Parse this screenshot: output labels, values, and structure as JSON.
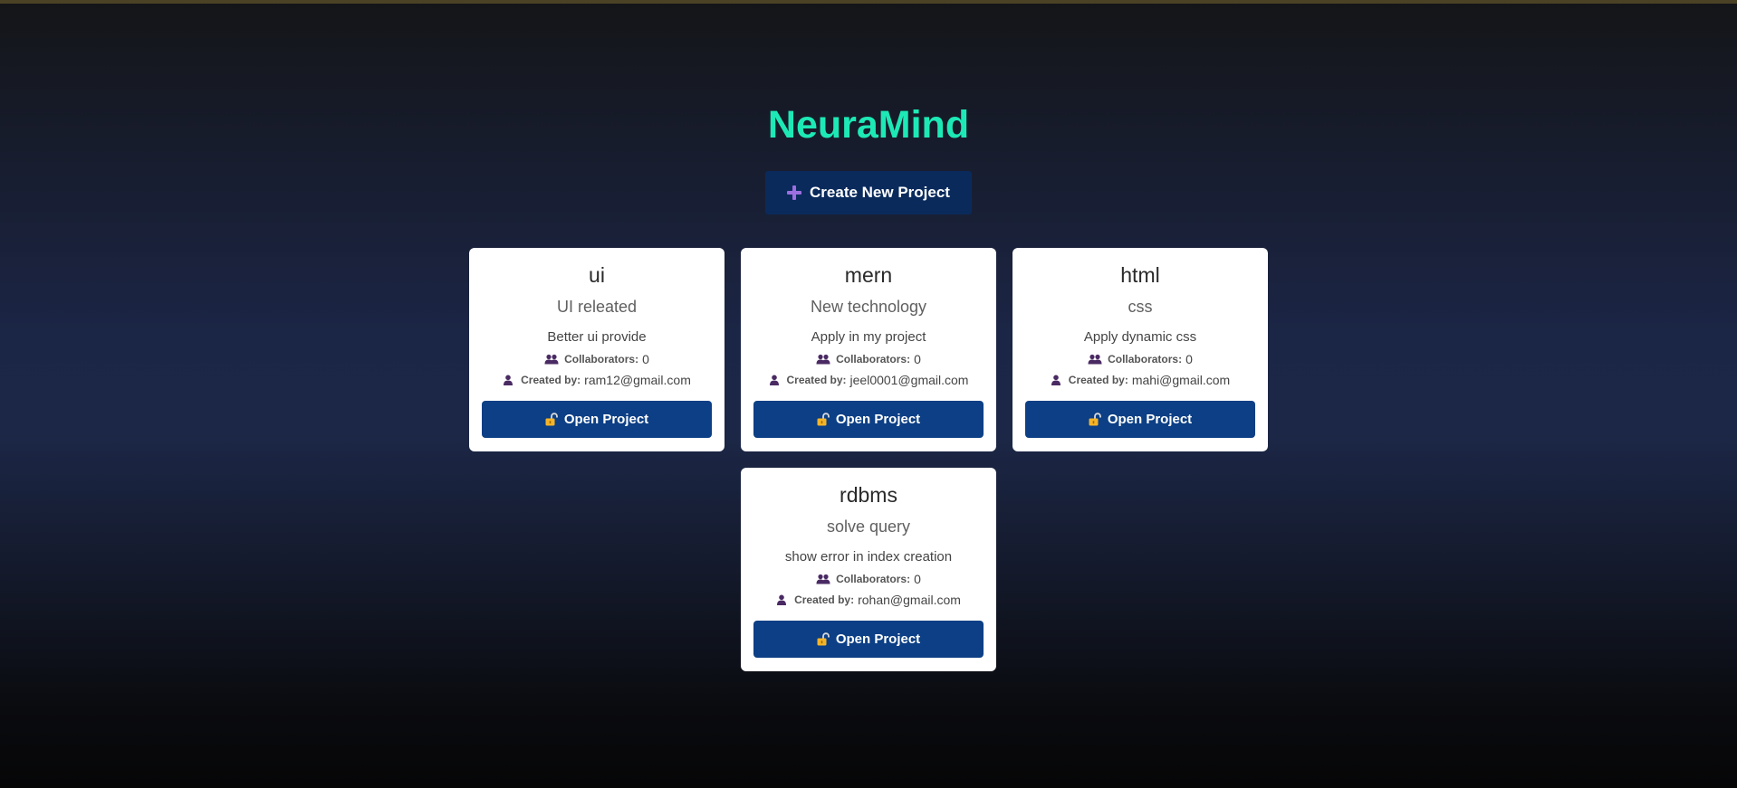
{
  "app": {
    "title": "NeuraMind"
  },
  "toolbar": {
    "create_label": "Create New Project"
  },
  "labels": {
    "collaborators": "Collaborators:",
    "created_by": "Created by:",
    "open_project": "Open Project"
  },
  "projects": [
    {
      "name": "ui",
      "subtitle": "UI releated",
      "description": "Better ui provide",
      "collaborators": "0",
      "created_by": "ram12@gmail.com"
    },
    {
      "name": "mern",
      "subtitle": "New technology",
      "description": "Apply in my project",
      "collaborators": "0",
      "created_by": "jeel0001@gmail.com"
    },
    {
      "name": "html",
      "subtitle": "css",
      "description": "Apply dynamic css",
      "collaborators": "0",
      "created_by": "mahi@gmail.com"
    },
    {
      "name": "rdbms",
      "subtitle": "solve query",
      "description": "show error in index creation",
      "collaborators": "0",
      "created_by": "rohan@gmail.com"
    }
  ],
  "colors": {
    "title": "#1de9b6",
    "create_button": "#0a2a5c",
    "open_button": "#0c3f85",
    "plus_icon": "#9b6fe0",
    "unlock_icon": "#f5b428"
  },
  "icons": {
    "create": "plus-icon",
    "collaborators": "users-icon",
    "created_by": "user-icon",
    "open": "unlock-icon"
  }
}
